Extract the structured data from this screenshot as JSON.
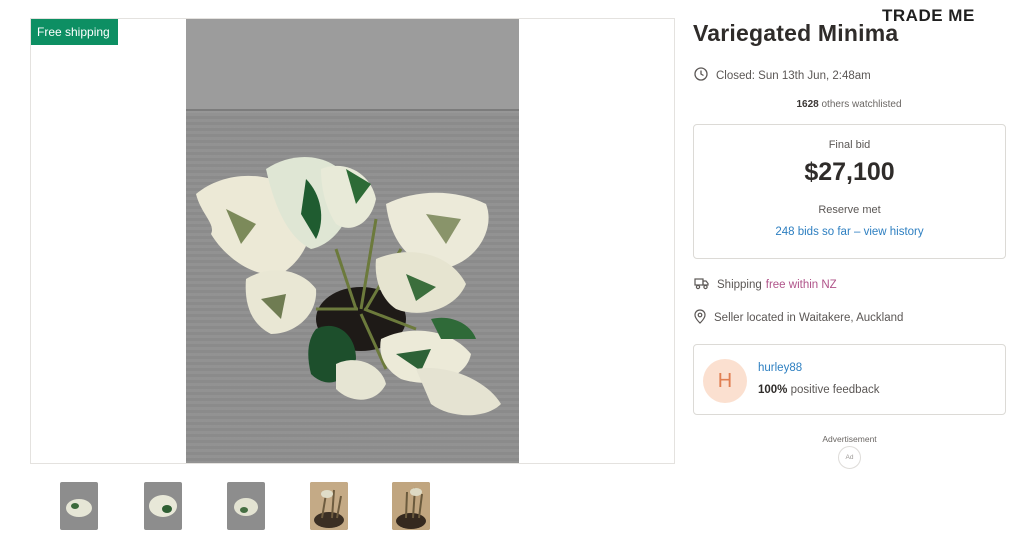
{
  "brand": "TRADE ME",
  "listing": {
    "badge": "Free shipping",
    "title": "Variegated Minima",
    "closed": "Closed: Sun 13th Jun, 2:48am",
    "watchlist_count": "1628",
    "watchlist_suffix": " others watchlisted",
    "final_bid_label": "Final bid",
    "final_bid": "$27,100",
    "reserve": "Reserve met",
    "bid_history": "248 bids so far – view history",
    "shipping_label": "Shipping",
    "shipping_value": "free within NZ",
    "seller_location": "Seller located in Waitakere, Auckland"
  },
  "seller": {
    "initial": "H",
    "username": "hurley88",
    "feedback_pct": "100%",
    "feedback_suffix": " positive feedback"
  },
  "ad": {
    "label": "Advertisement",
    "badge": "Ad"
  },
  "thumbnails": [
    {
      "name": "thumbnail-1",
      "tone": "gray"
    },
    {
      "name": "thumbnail-2",
      "tone": "gray"
    },
    {
      "name": "thumbnail-3",
      "tone": "gray"
    },
    {
      "name": "thumbnail-4",
      "tone": "tan"
    },
    {
      "name": "thumbnail-5",
      "tone": "tan"
    }
  ],
  "colors": {
    "badge_green": "#0d8f63",
    "link_blue": "#2d7fc1",
    "free_pink": "#b0548a",
    "avatar_bg": "#fbe0d0",
    "avatar_fg": "#e07f52"
  },
  "icons": [
    "clock-icon",
    "truck-icon",
    "location-pin-icon"
  ]
}
